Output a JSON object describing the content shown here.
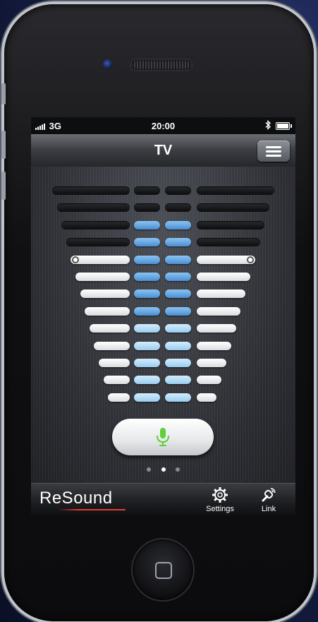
{
  "status_bar": {
    "signal": "3G",
    "time": "20:00",
    "bluetooth_icon": "bluetooth-icon",
    "battery_icon": "battery-icon"
  },
  "nav": {
    "title": "TV",
    "menu_icon": "menu-icon"
  },
  "equalizer": {
    "selected_level": 5,
    "band_colors": {
      "dark": "#0c0c0e",
      "white": "#ffffff",
      "blue": "#4a8fd2",
      "light_blue": "#99cdf0"
    }
  },
  "mic_button": {
    "icon": "microphone-icon",
    "color": "#5fcf3b"
  },
  "page_indicator": {
    "pages": 3,
    "active": 1
  },
  "tab_bar": {
    "brand": "ReSound",
    "brand_color": "#e53935",
    "tabs": [
      {
        "label": "Settings",
        "icon": "gear-icon"
      },
      {
        "label": "Link",
        "icon": "link-icon"
      }
    ]
  }
}
